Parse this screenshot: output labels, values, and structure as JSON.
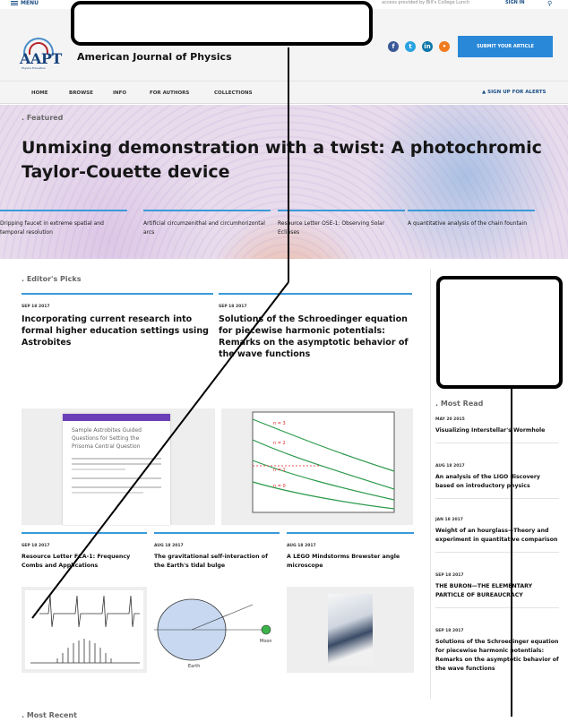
{
  "topbar": {
    "menu_label": "MENU",
    "access_text": "access provided by Bill's College Lunch",
    "sign_in": "SIGN IN",
    "search_icon": "search-icon"
  },
  "header": {
    "logo_text": "AAPT",
    "logo_subtext": "Physics Education",
    "journal_title": "American Journal of Physics",
    "submit_label": "SUBMIT YOUR ARTICLE",
    "social_icons": [
      "facebook-icon",
      "twitter-icon",
      "linkedin-icon",
      "rss-icon"
    ],
    "colors": {
      "brand": "#17427c",
      "accent": "#2a88d8"
    }
  },
  "nav": {
    "items": [
      "HOME",
      "BROWSE",
      "INFO",
      "FOR AUTHORS",
      "COLLECTIONS"
    ],
    "alerts": "SIGN UP FOR ALERTS"
  },
  "featured": {
    "label": "Featured",
    "title": "Unmixing demonstration with a twist: A photochromic Taylor-Couette device",
    "items": [
      "Dripping faucet in extreme spatial and temporal resolution",
      "Artificial circumzenithal and circumhorizontal arcs",
      "Resource Letter OSE-1: Observing Solar Eclipses",
      "A quantitative analysis of the chain fountain"
    ]
  },
  "editors_picks": {
    "label": "Editor's Picks",
    "large": [
      {
        "date": "SEP 18 2017",
        "title": "Incorporating current research into formal higher education settings using Astrobites"
      },
      {
        "date": "SEP 18 2017",
        "title": "Solutions of the Schroedinger equation for piecewise harmonic potentials: Remarks on the asymptotic behavior of the wave functions"
      }
    ],
    "small": [
      {
        "date": "SEP 18 2017",
        "title": "Resource Letter FCA-1: Frequency Combs and Applications"
      },
      {
        "date": "AUG 18 2017",
        "title": "The gravitational self-interaction of the Earth's tidal bulge"
      },
      {
        "date": "AUG 18 2017",
        "title": "A LEGO Mindstorms Brewster angle microscope"
      }
    ],
    "thumb1_caption": "Sample Astrobites Guided Questions for Setting the Prisoma Central Question",
    "graph_labels": [
      "n = 3",
      "n = 2",
      "n = 1",
      "n = 0"
    ],
    "orbit_labels": [
      "Earth",
      "Moon"
    ]
  },
  "most_read": {
    "label": "Most Read",
    "items": [
      {
        "date": "MAY 20 2015",
        "title": "Visualizing Interstellar's Wormhole"
      },
      {
        "date": "AUG 18 2017",
        "title": "An analysis of the LIGO discovery based on introductory physics"
      },
      {
        "date": "JAN 18 2017",
        "title": "Weight of an hourglass—Theory and experiment in quantitative comparison"
      },
      {
        "date": "SEP 18 2017",
        "title": "THE BURON—THE ELEMENTARY PARTICLE OF BUREAUCRACY"
      },
      {
        "date": "SEP 18 2017",
        "title": "Solutions of the Schroedinger equation for piecewise harmonic potentials: Remarks on the asymptotic behavior of the wave functions"
      }
    ]
  },
  "most_recent": {
    "label": "Most Recent"
  }
}
